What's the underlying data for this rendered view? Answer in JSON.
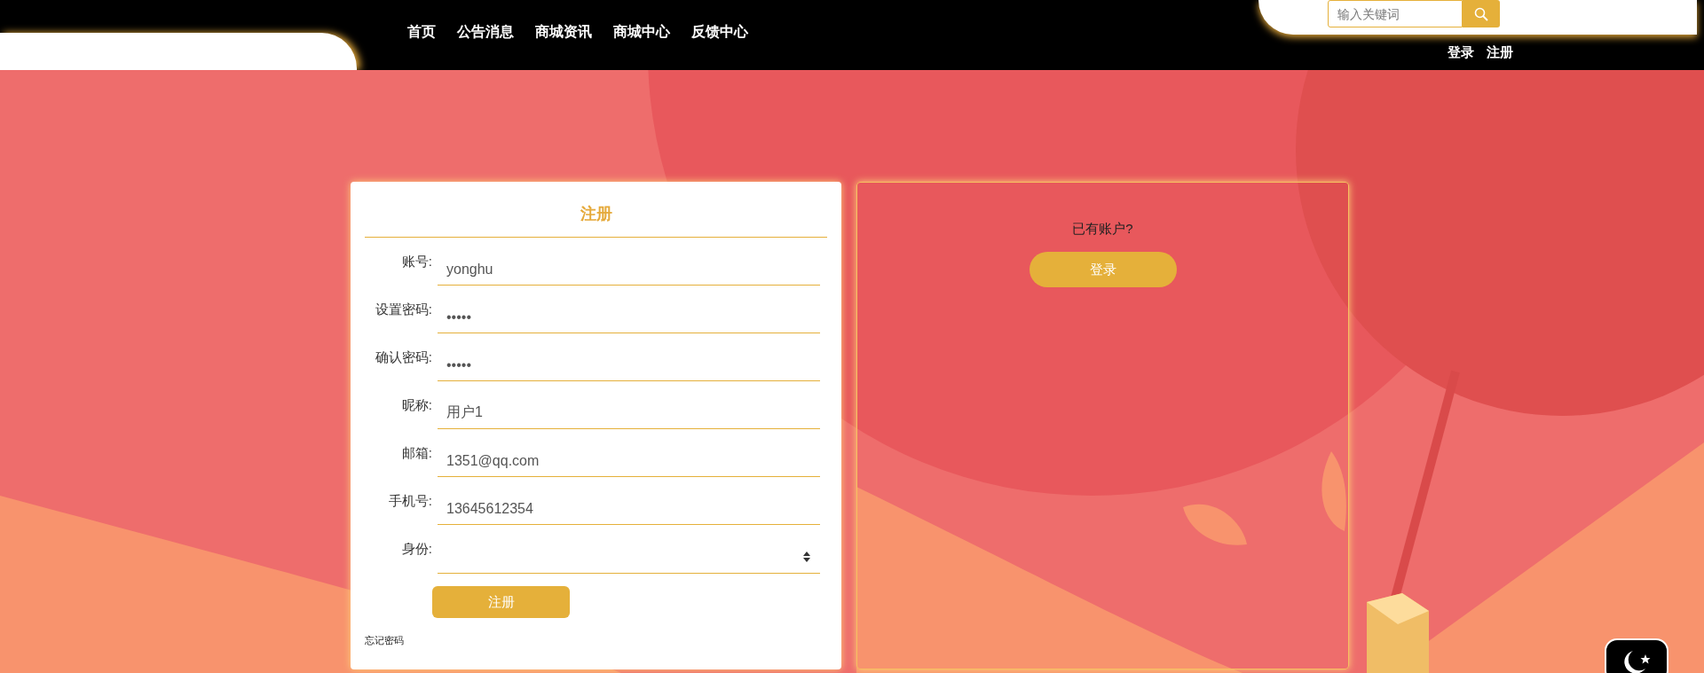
{
  "nav": [
    {
      "label": "首页"
    },
    {
      "label": "公告消息"
    },
    {
      "label": "商城资讯"
    },
    {
      "label": "商城中心"
    },
    {
      "label": "反馈中心"
    }
  ],
  "search": {
    "placeholder": "输入关键词"
  },
  "account_links": [
    "登录",
    "注册"
  ],
  "register_form": {
    "title": "注册",
    "fields": [
      {
        "label": "账号:",
        "kind": "text",
        "value": "yonghu"
      },
      {
        "label": "设置密码:",
        "kind": "text",
        "value": "•••••"
      },
      {
        "label": "确认密码:",
        "kind": "text",
        "value": "•••••"
      },
      {
        "label": "昵称:",
        "kind": "text",
        "value": "用户1"
      },
      {
        "label": "邮箱:",
        "kind": "text",
        "value": "1351@qq.com"
      },
      {
        "label": "手机号:",
        "kind": "text",
        "value": "13645612354"
      },
      {
        "label": "身份:",
        "kind": "select"
      }
    ],
    "submit": "注册",
    "forgot_link": "忘记密码"
  },
  "login_panel": {
    "prompt": "已有账户?",
    "button": "登录"
  }
}
